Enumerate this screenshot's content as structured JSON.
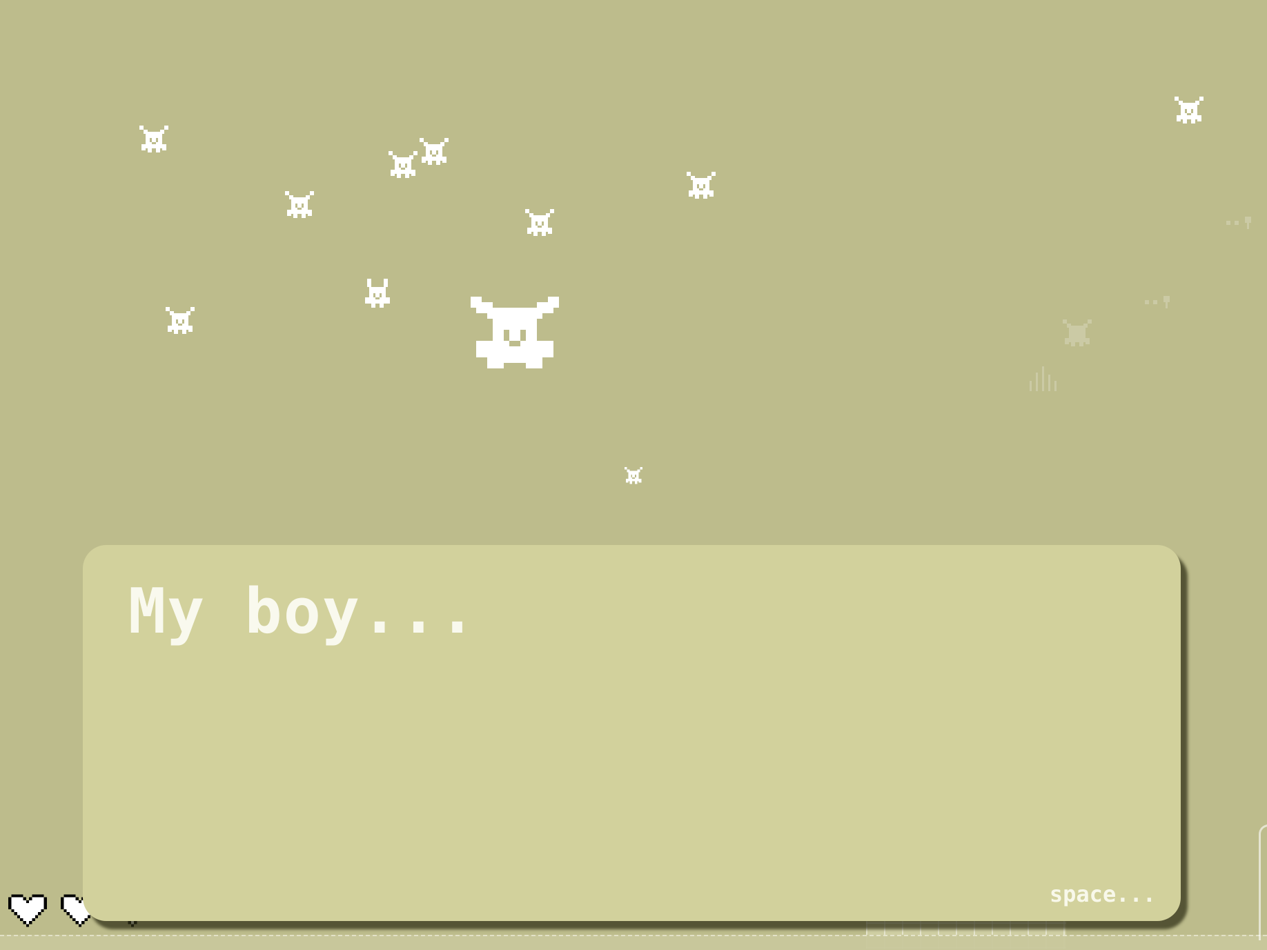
{
  "dialog": {
    "text": "My boy...",
    "continue_hint": "space..."
  },
  "hud": {
    "hearts": [
      "heart-icon",
      "heart-icon",
      "heart-icon"
    ]
  },
  "scene": {
    "background_color": "#bdbc8c",
    "dialog_color": "#d2d19c",
    "sprite_color": "#ffffff"
  }
}
